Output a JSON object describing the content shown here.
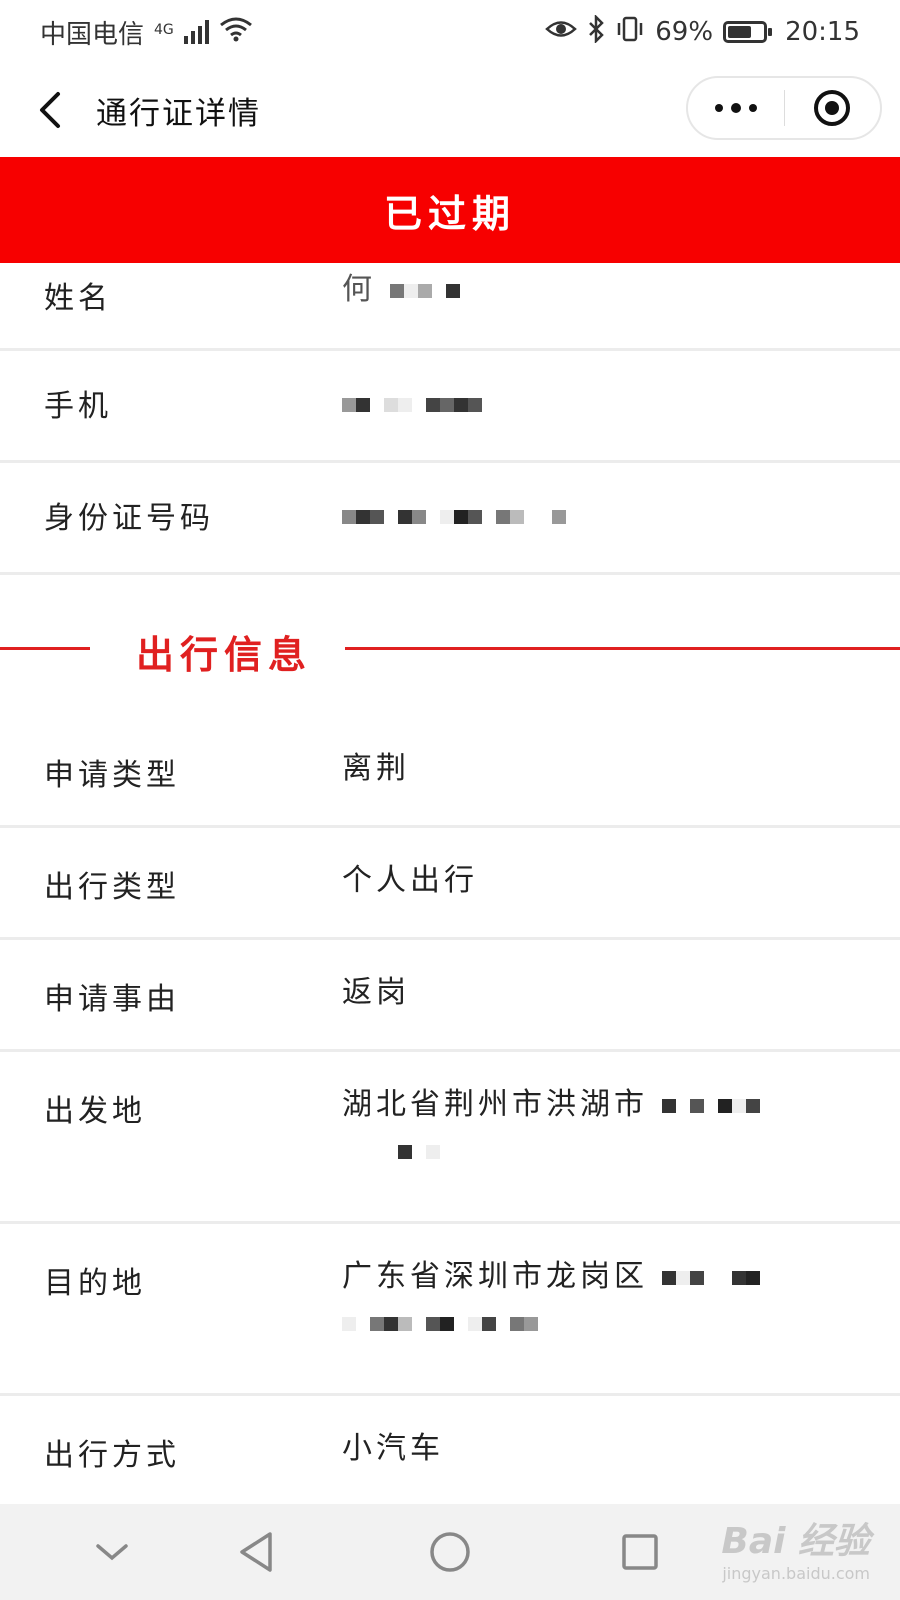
{
  "status_bar": {
    "carrier": "中国电信",
    "network": "4G",
    "battery_percent": "69%",
    "time": "20:15"
  },
  "nav": {
    "title": "通行证详情"
  },
  "banner": {
    "status_text": "已过期",
    "color": "#f70000"
  },
  "personal_info": [
    {
      "label": "姓名",
      "value": "何"
    },
    {
      "label": "手机",
      "value": ""
    },
    {
      "label": "身份证号码",
      "value": ""
    }
  ],
  "section": {
    "title": "出行信息",
    "color": "#e02020"
  },
  "trip_info": [
    {
      "label": "申请类型",
      "value": "离荆"
    },
    {
      "label": "出行类型",
      "value": "个人出行"
    },
    {
      "label": "申请事由",
      "value": "返岗"
    },
    {
      "label": "出发地",
      "value": "湖北省荆州市洪湖市"
    },
    {
      "label": "目的地",
      "value": "广东省深圳市龙岗区"
    },
    {
      "label": "出行方式",
      "value": "小汽车"
    }
  ],
  "watermark": {
    "main": "Bai 经验",
    "sub": "jingyan.baidu.com"
  }
}
